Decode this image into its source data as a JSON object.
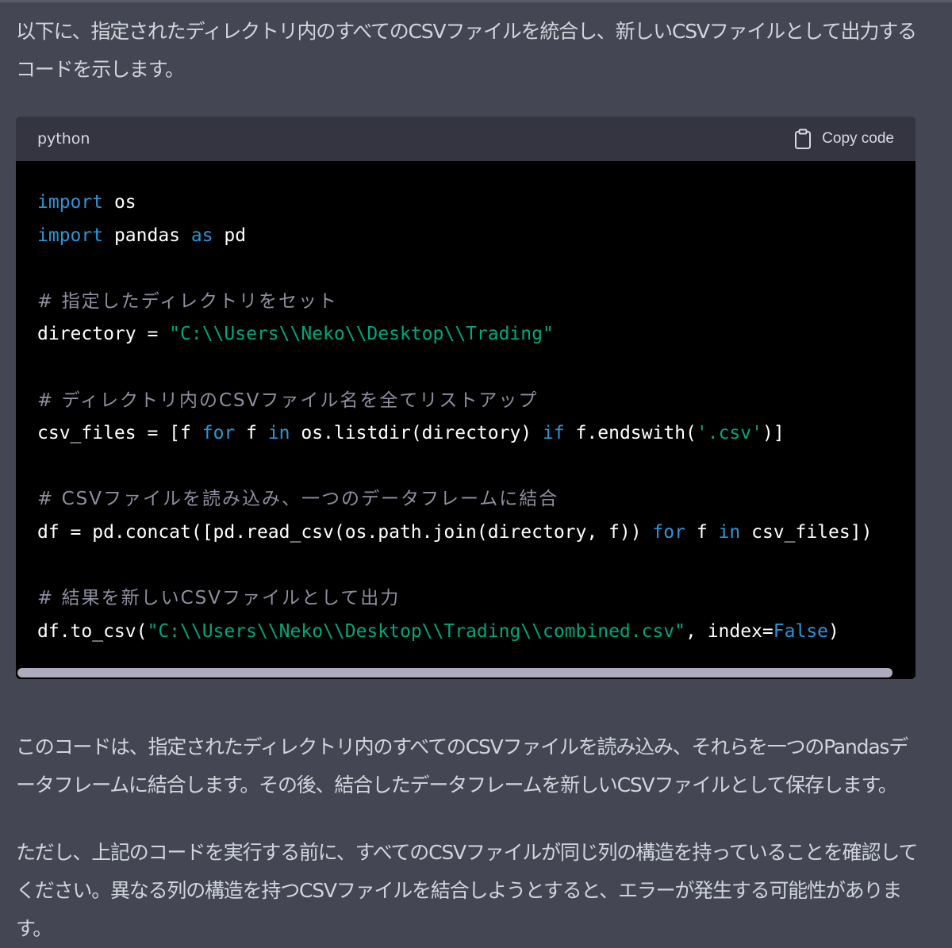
{
  "intro": "以下に、指定されたディレクトリ内のすべてのCSVファイルを統合し、新しいCSVファイルとして出力するコードを示します。",
  "code_block": {
    "language": "python",
    "copy_label": "Copy code",
    "copy_icon": "clipboard-icon",
    "lines": {
      "l1": {
        "k1": "import",
        "t1": " os"
      },
      "l2": {
        "k1": "import",
        "t1": " pandas ",
        "k2": "as",
        "t2": " pd"
      },
      "l4": {
        "c": "# 指定したディレクトリをセット"
      },
      "l5": {
        "t1": "directory = ",
        "s1": "\"C:\\\\Users\\\\Neko\\\\Desktop\\\\Trading\""
      },
      "l7": {
        "c": "# ディレクトリ内のCSVファイル名を全てリストアップ"
      },
      "l8": {
        "t1": "csv_files = [f ",
        "k1": "for",
        "t2": " f ",
        "k2": "in",
        "t3": " os.listdir(directory) ",
        "k3": "if",
        "t4": " f.endswith(",
        "s1": "'.csv'",
        "t5": ")]"
      },
      "l10": {
        "c": "# CSVファイルを読み込み、一つのデータフレームに結合"
      },
      "l11": {
        "t1": "df = pd.concat([pd.read_csv(os.path.join(directory, f)) ",
        "k1": "for",
        "t2": " f ",
        "k2": "in",
        "t3": " csv_files])"
      },
      "l13": {
        "c": "# 結果を新しいCSVファイルとして出力"
      },
      "l14": {
        "t1": "df.to_csv(",
        "s1": "\"C:\\\\Users\\\\Neko\\\\Desktop\\\\Trading\\\\combined.csv\"",
        "t2": ", index=",
        "k1": "False",
        "t3": ")"
      }
    }
  },
  "explanation": "このコードは、指定されたディレクトリ内のすべてのCSVファイルを読み込み、それらを一つのPandasデータフレームに結合します。その後、結合したデータフレームを新しいCSVファイルとして保存します。",
  "note": "ただし、上記のコードを実行する前に、すべてのCSVファイルが同じ列の構造を持っていることを確認してください。異なる列の構造を持つCSVファイルを結合しようとすると、エラーが発生する可能性があります。",
  "colors": {
    "page_bg": "#444654",
    "code_bg": "#000000",
    "header_bg": "#343541",
    "keyword": "#2e95d3",
    "string": "#00a67d",
    "comment": "#8e8ea0"
  }
}
